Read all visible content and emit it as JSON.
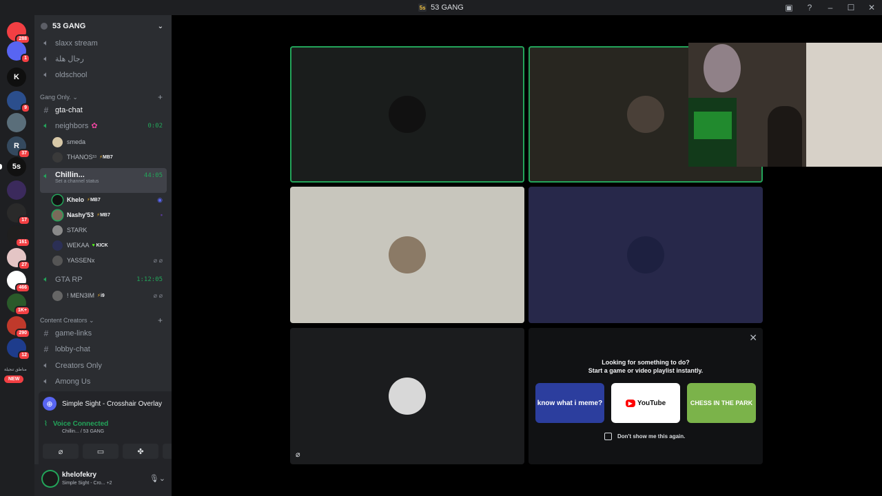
{
  "window": {
    "title": "53 GANG",
    "server_icon": "5s"
  },
  "rail": {
    "servers": [
      {
        "label": "",
        "badge": "288",
        "color": "#f23f43"
      },
      {
        "label": "",
        "badge": "1",
        "color": "#5865f2"
      },
      {
        "label": "K",
        "badge": "",
        "color": "#0f0f0f"
      },
      {
        "label": "",
        "badge": "9",
        "color": "#2b4e8c"
      },
      {
        "label": "",
        "badge": "",
        "color": "#5a6e7a"
      },
      {
        "label": "R",
        "badge": "37",
        "color": "#34495e"
      },
      {
        "label": "5s",
        "badge": "",
        "color": "#111111"
      },
      {
        "label": "",
        "badge": "",
        "color": "#3b2a5c"
      },
      {
        "label": "",
        "badge": "17",
        "color": "#2a2a2a"
      },
      {
        "label": "",
        "badge": "161",
        "color": "#1f1f1f"
      },
      {
        "label": "",
        "badge": "27",
        "color": "#e4c5c5"
      },
      {
        "label": "",
        "badge": "466",
        "color": "#ffffff"
      },
      {
        "label": "",
        "badge": "1K+",
        "color": "#2a5a2a"
      },
      {
        "label": "",
        "badge": "290",
        "color": "#c0392b"
      },
      {
        "label": "",
        "badge": "12",
        "color": "#1e3c8c"
      }
    ],
    "new_badge": "NEW",
    "arabic_label": "مناطق تنجيلة"
  },
  "sidebar": {
    "server_name": "53 GANG",
    "top_channels": [
      "slaxx stream",
      "رجال هلة",
      "oldschool"
    ],
    "category1": "Gang Only.",
    "gta_chat": "gta-chat",
    "neighbors": {
      "name": "neighbors",
      "time": "0:02",
      "users": [
        {
          "name": "smeda",
          "tag": ""
        },
        {
          "name": "THANOS",
          "tag": "MB7",
          "suffix": "53"
        }
      ]
    },
    "chillin": {
      "name": "Chillin...",
      "status": "Set a channel status",
      "time": "44:05",
      "users": [
        {
          "name": "Khelo",
          "tag": "MB7"
        },
        {
          "name": "Nashy'53",
          "tag": "MB7"
        },
        {
          "name": "STARK",
          "tag": ""
        },
        {
          "name": "WEKAA",
          "tag": "KICK"
        },
        {
          "name": "YASSENx",
          "tag": ""
        }
      ]
    },
    "gtarp": {
      "name": "GTA RP",
      "time": "1:12:05",
      "users": [
        {
          "name": "! MEN3IM",
          "tag": "i9"
        }
      ]
    },
    "category2": "Content Creators",
    "cc_channels": [
      "game-links",
      "lobby-chat",
      "Creators Only",
      "Among Us"
    ]
  },
  "activity": {
    "name": "Simple Sight - Crosshair Overlay"
  },
  "voice": {
    "status": "Voice Connected",
    "location": "Chillin... / 53 GANG"
  },
  "user": {
    "name": "khelofekry",
    "status": "Simple Sight - Cro...",
    "extra": "+2"
  },
  "activity_prompt": {
    "line1": "Looking for something to do?",
    "line2": "Start a game or video playlist instantly.",
    "meme_label": "know what i meme?",
    "youtube_label": "YouTube",
    "chess_label": "CHESS IN THE PARK",
    "dont_show": "Don't show me this again."
  },
  "colors": {
    "green": "#23a55a",
    "bg": "#2b2d31",
    "rail": "#1e1f22"
  }
}
